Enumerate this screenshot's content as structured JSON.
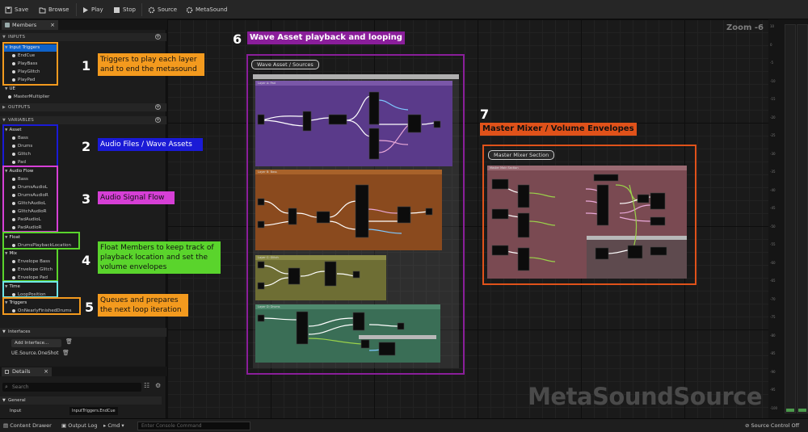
{
  "toolbar": {
    "save": "Save",
    "browse": "Browse",
    "play": "Play",
    "stop": "Stop",
    "source": "Source",
    "metasound": "MetaSound"
  },
  "members_panel": {
    "tab": "Members",
    "sections": {
      "inputs": "INPUTS",
      "outputs": "OUTPUTS",
      "variables": "VARIABLES"
    },
    "input_categories": [
      {
        "name": "Input Triggers",
        "items": [
          "EndCue",
          "PlayBass",
          "PlayGlitch",
          "PlayPad"
        ]
      },
      {
        "name": "UE",
        "items": [
          "MasterMultiplier"
        ]
      }
    ],
    "variable_categories": [
      {
        "name": "Asset",
        "items": [
          "Bass",
          "Drums",
          "Glitch",
          "Pad"
        ]
      },
      {
        "name": "Audio Flow",
        "items": [
          "Bass",
          "DrumsAudioL",
          "DrumsAudioR",
          "GlitchAudioL",
          "GlitchAudioR",
          "PadAudioL",
          "PadAudioR"
        ]
      },
      {
        "name": "Float",
        "items": [
          "DrumsPlaybackLocation"
        ]
      },
      {
        "name": "Mix",
        "items": [
          "Envelope Bass",
          "Envelope Glitch",
          "Envelope Pad"
        ]
      },
      {
        "name": "Time",
        "items": [
          "LoopPosition"
        ]
      },
      {
        "name": "Triggers",
        "items": [
          "OnNearlyFinishedDrums"
        ]
      }
    ]
  },
  "interfaces_panel": {
    "title": "Interfaces",
    "add_button": "Add Interface...",
    "item": "UE.Source.OneShot"
  },
  "details_panel": {
    "tab": "Details",
    "search_placeholder": "Search",
    "general": "General",
    "input_label": "Input",
    "input_value": "InputTriggers.EndCue"
  },
  "status_bar": {
    "content_drawer": "Content Drawer",
    "output_log": "Output Log",
    "cmd": "Cmd",
    "console_placeholder": "Enter Console Command",
    "source_control": "Source Control Off"
  },
  "graph": {
    "zoom": "Zoom -6",
    "watermark": "MetaSoundSource",
    "comment_wave": "Wave Asset / Sources",
    "comment_mixer": "Master Mixer Section",
    "layer_labels": [
      "Layer A: Pad",
      "Layer B: Bass",
      "Layer C: Glitch",
      "Layer D: Drums"
    ],
    "mixer_label": "Master Main Section"
  },
  "annotations": [
    {
      "num": "1",
      "text": "Triggers to play each layer and to end the metasound",
      "color": "#f39a1e"
    },
    {
      "num": "2",
      "text": "Audio Files / Wave Assets",
      "color": "#1a1ad6"
    },
    {
      "num": "3",
      "text": "Audio Signal Flow",
      "color": "#d63fd6"
    },
    {
      "num": "4",
      "text": "Float Members to keep track of playback location and set the volume envelopes",
      "color": "#5ad42c"
    },
    {
      "num": "5",
      "text": "Queues and prepares the next loop iteration",
      "color": "#f39a1e"
    },
    {
      "num": "6",
      "text": "Wave Asset playback and looping",
      "color": "#8a1e9a"
    },
    {
      "num": "7",
      "text": "Master Mixer / Volume Envelopes",
      "color": "#e0521a"
    }
  ],
  "meter_scale": [
    "10",
    "0",
    "-5",
    "-10",
    "-15",
    "-20",
    "-25",
    "-30",
    "-35",
    "-40",
    "-45",
    "-50",
    "-55",
    "-60",
    "-65",
    "-70",
    "-75",
    "-80",
    "-85",
    "-90",
    "-95",
    "-100"
  ],
  "colors": {
    "selection": "#0f62c9",
    "layer_pad": "#5a3a8a",
    "layer_bass": "#8a4a1e",
    "layer_glitch": "#6e6e34",
    "layer_drums": "#3a6e56",
    "mixer": "#7a4a52"
  }
}
